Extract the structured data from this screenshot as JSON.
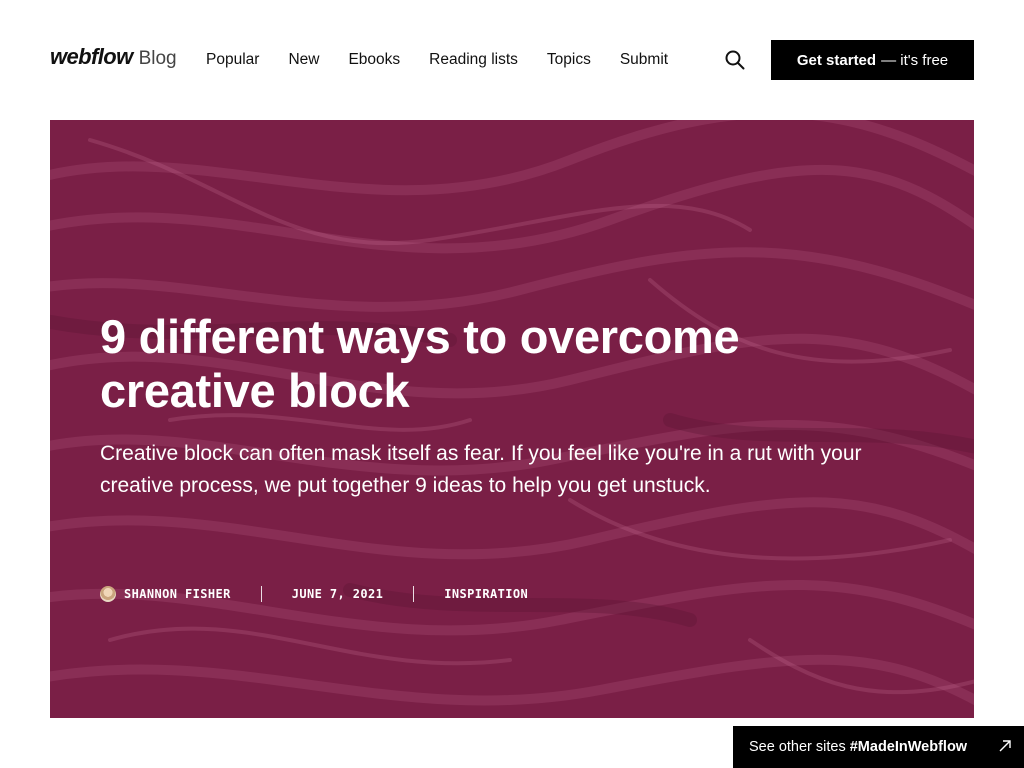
{
  "brand": {
    "logo": "webflow",
    "sub": "Blog"
  },
  "nav": {
    "links": [
      "Popular",
      "New",
      "Ebooks",
      "Reading lists",
      "Topics",
      "Submit"
    ],
    "search_icon": "search-icon",
    "cta_bold": "Get started",
    "cta_rest": "— it's free"
  },
  "hero": {
    "background_color": "#7c2047",
    "title": "9 different ways to overcome creative block",
    "description": "Creative block can often mask itself as fear. If you feel like you're in a rut with your creative process, we put together 9 ideas to help you get unstuck.",
    "author": "SHANNON FISHER",
    "date": "JUNE 7, 2021",
    "category": "INSPIRATION"
  },
  "badge": {
    "prefix": "See other sites",
    "tag": "#MadeInWebflow",
    "icon": "arrow-up-right-icon"
  }
}
